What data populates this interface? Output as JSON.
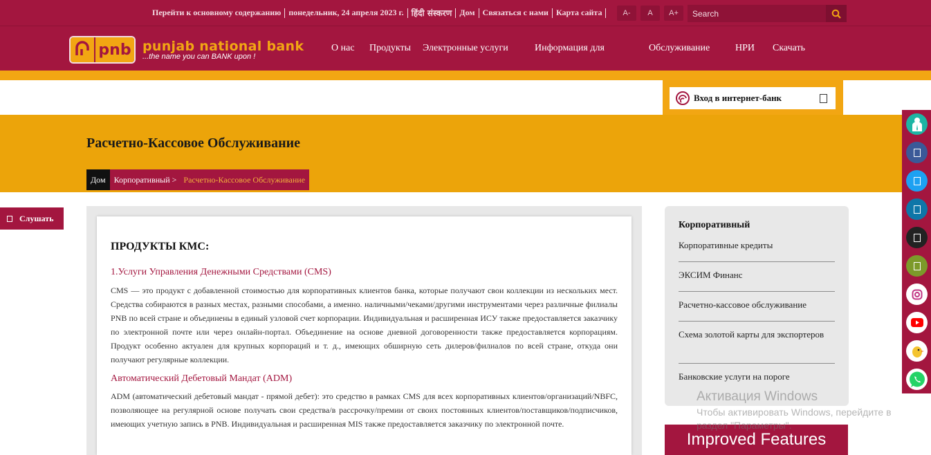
{
  "topbar": {
    "skip_link": "Перейти к основному содержанию",
    "date": "понедельник, 24 апреля 2023 г.",
    "hindi": "हिंदी संस्करण",
    "home": "Дом",
    "contact": "Связаться с нами",
    "sitemap": "Карта сайта",
    "font_small": "A-",
    "font_normal": "A",
    "font_large": "A+",
    "search_placeholder": "Search"
  },
  "logo": {
    "badge_text": "pnb",
    "name": "punjab national bank",
    "tagline": "...the name you can BANK upon !"
  },
  "nav": {
    "items": [
      "О нас",
      "Продукты",
      "Электронные услуги",
      "Информация для",
      "Обслуживание",
      "НРИ",
      "Скачать"
    ]
  },
  "login": {
    "label": "Вход в интернет-банк"
  },
  "banner": {
    "title": "Расчетно-Кассовое Обслуживание",
    "breadcrumb": {
      "home": "Дом",
      "parent": "Корпоративный >",
      "current": "Расчетно-Кассовое Обслуживание"
    }
  },
  "listen": {
    "label": "Слушать"
  },
  "content": {
    "heading": "ПРОДУКТЫ КМС:",
    "sections": [
      {
        "title": "1.Услуги Управления Денежными Средствами (CMS)",
        "text": "CMS — это продукт с добавленной стоимостью для корпоративных клиентов банка, которые получают свои коллекции из нескольких мест. Средства собираются в разных местах, разными способами, а именно. наличными/чеками/другими инструментами через различные филиалы PNB по всей стране и объединены в единый узловой счет корпорации. Индивидуальная и расширенная ИСУ также предоставляется заказчику по электронной почте или через онлайн-портал. Объединение на основе дневной договоренности также предоставляется корпорациям. Продукт особенно актуален для крупных корпораций и т. д., имеющих обширную сеть дилеров/филиалов по всей стране, откуда они получают регулярные коллекции."
      },
      {
        "title": "Автоматический Дебетовый Мандат (ADM)",
        "text": "ADM (автоматический дебетовый мандат - прямой дебет): это средство в рамках CMS для всех корпоративных клиентов/организаций/NBFC, позволяющее на регулярной основе получать свои средства/в рассрочку/премии от своих постоянных клиентов/поставщиков/подписчиков, имеющих учетную запись в PNB. Индивидуальная и расширенная MIS также предоставляется заказчику по электронной почте."
      }
    ]
  },
  "sidebar": {
    "title": "Корпоративный",
    "items": [
      "Корпоративные кредиты",
      "ЭКСИМ Финанс",
      "Расчетно-кассовое обслуживание",
      "Схема золотой карты для экспортеров",
      "Банковские услуги на пороге"
    ]
  },
  "promo": {
    "label": "Improved Features"
  },
  "watermark": {
    "title": "Активация Windows",
    "text": "Чтобы активировать Windows, перейдите в раздел \"Параметры\"."
  },
  "social": {
    "icons": [
      "person-icon",
      "facebook-icon",
      "twitter-icon",
      "linkedin-icon",
      "koo-icon",
      "android-icon",
      "instagram-icon",
      "youtube-icon",
      "koo-bird-icon",
      "whatsapp-icon"
    ],
    "colors": [
      "#1db5a4",
      "#3b5998",
      "#1da1f2",
      "#0e76a8",
      "#222222",
      "#7c9a2a",
      "#ffffff",
      "#ffffff",
      "#ffffff",
      "#ffffff"
    ]
  },
  "colors": {
    "brand": "#a3163f",
    "accent": "#f2a613",
    "banner": "#eca40a"
  }
}
